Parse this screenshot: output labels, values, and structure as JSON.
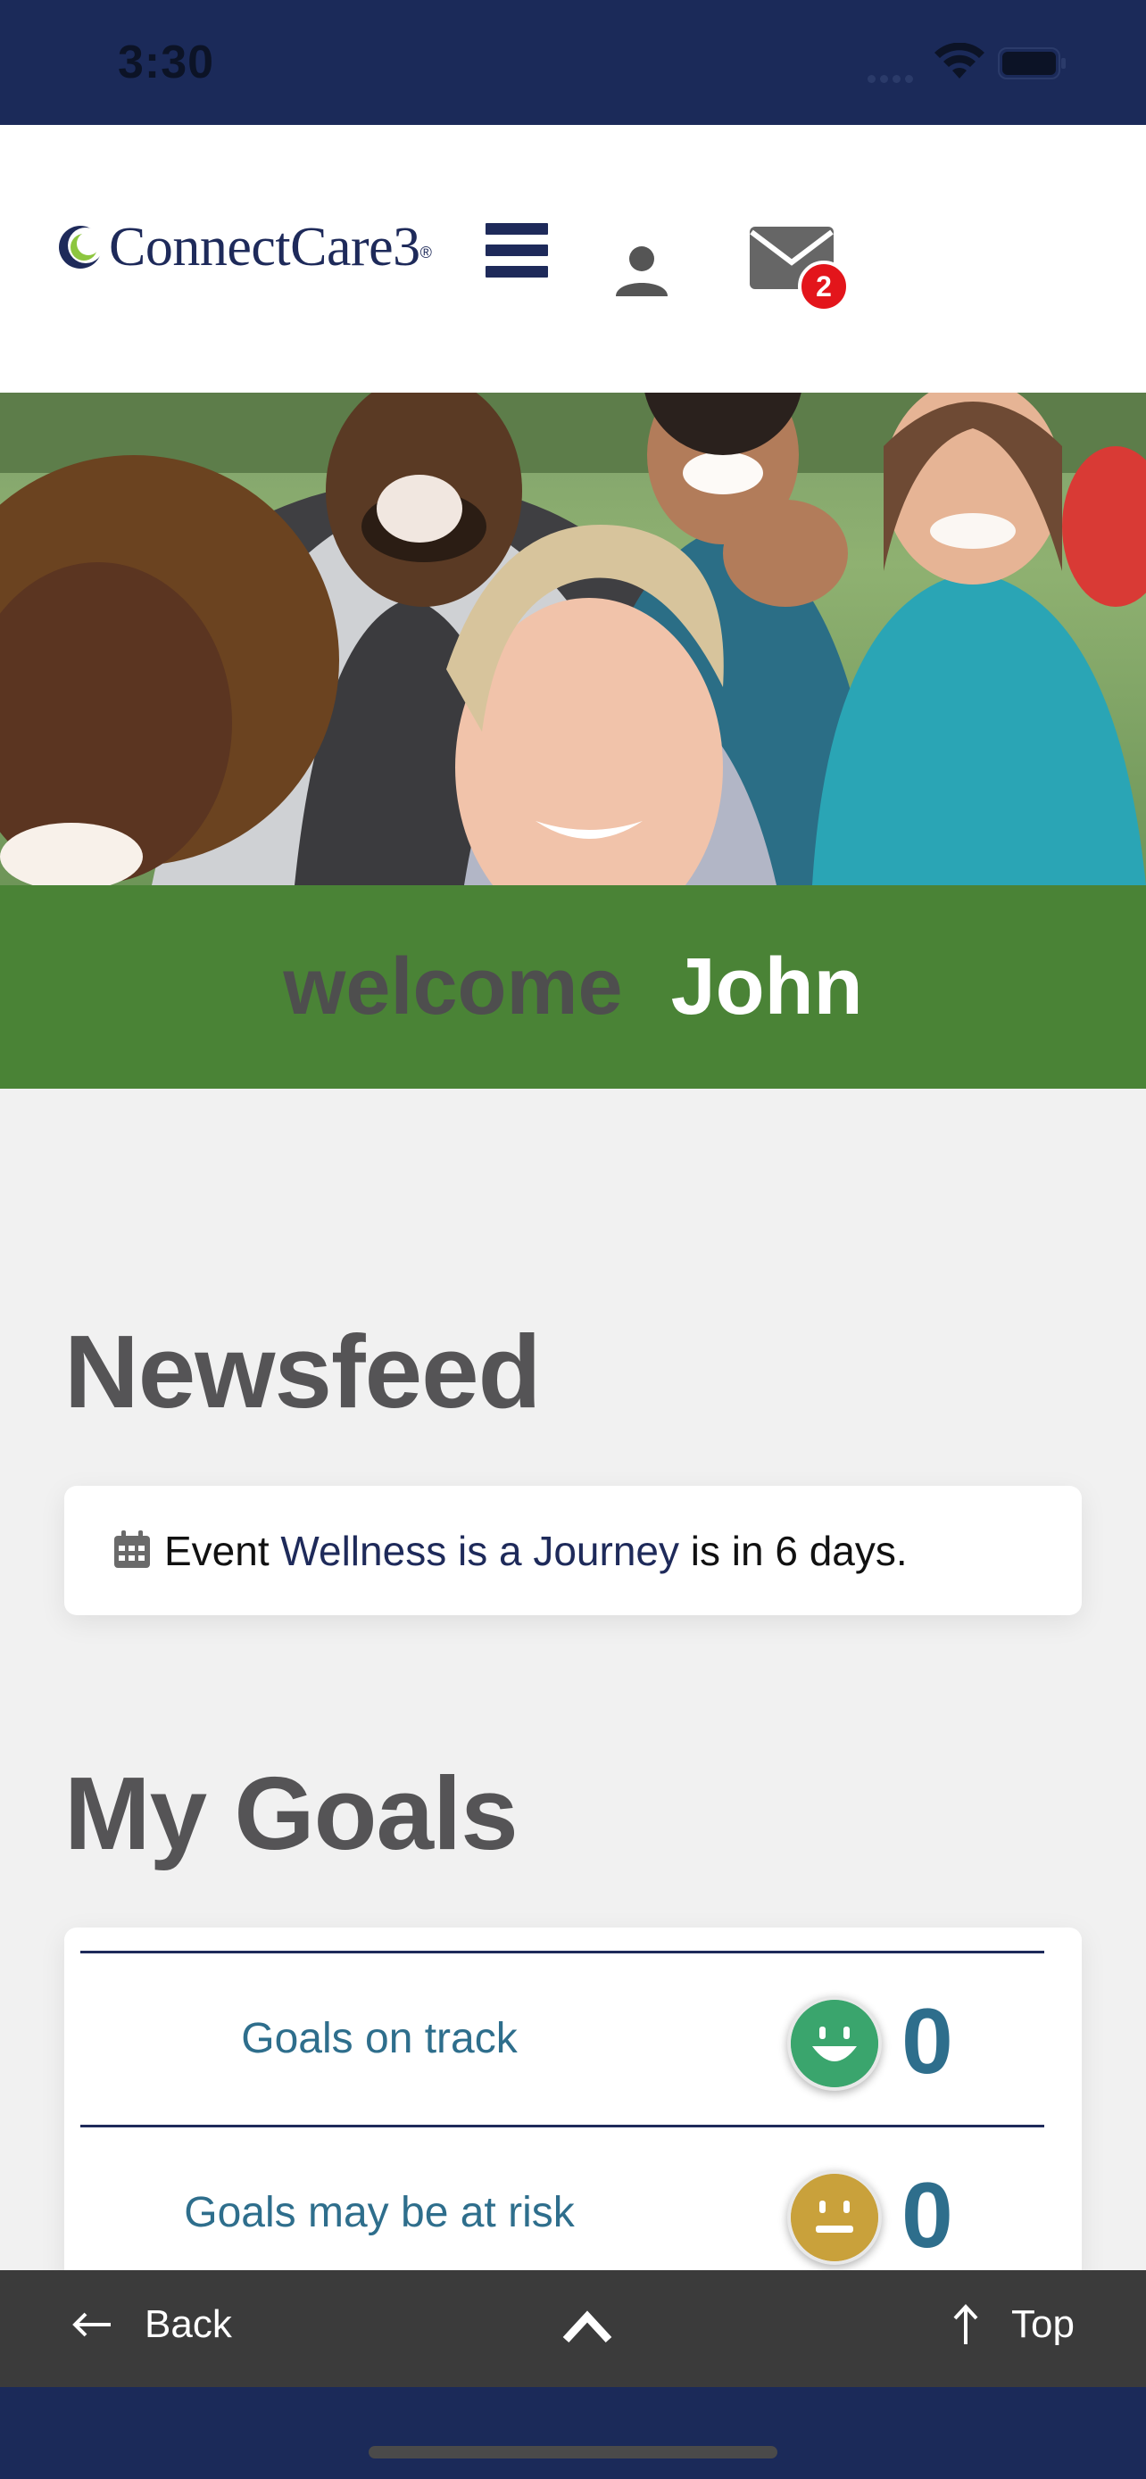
{
  "status_bar": {
    "time": "3:30"
  },
  "header": {
    "logo_text": "ConnectCare3",
    "logo_reg": "®",
    "mail_badge_count": "2"
  },
  "hero": {
    "alt": "Group of smiling people outdoors"
  },
  "welcome": {
    "word": "welcome",
    "name": "John"
  },
  "newsfeed": {
    "title": "Newsfeed",
    "item": {
      "prefix": "Event",
      "link": "Wellness is a Journey",
      "suffix": "is in 6 days."
    }
  },
  "goals": {
    "title": "My Goals",
    "rows": [
      {
        "label": "Goals on track",
        "count": "0",
        "face": "happy",
        "color": "#3aa56d"
      },
      {
        "label": "Goals may be at risk",
        "count": "0",
        "face": "neutral",
        "color": "#c9a13b"
      }
    ]
  },
  "bottom_bar": {
    "back_label": "Back",
    "top_label": "Top"
  },
  "colors": {
    "navy": "#1b2a59",
    "green": "#4a8336",
    "accent_text": "#2e6e8c",
    "badge_red": "#e3151b"
  }
}
